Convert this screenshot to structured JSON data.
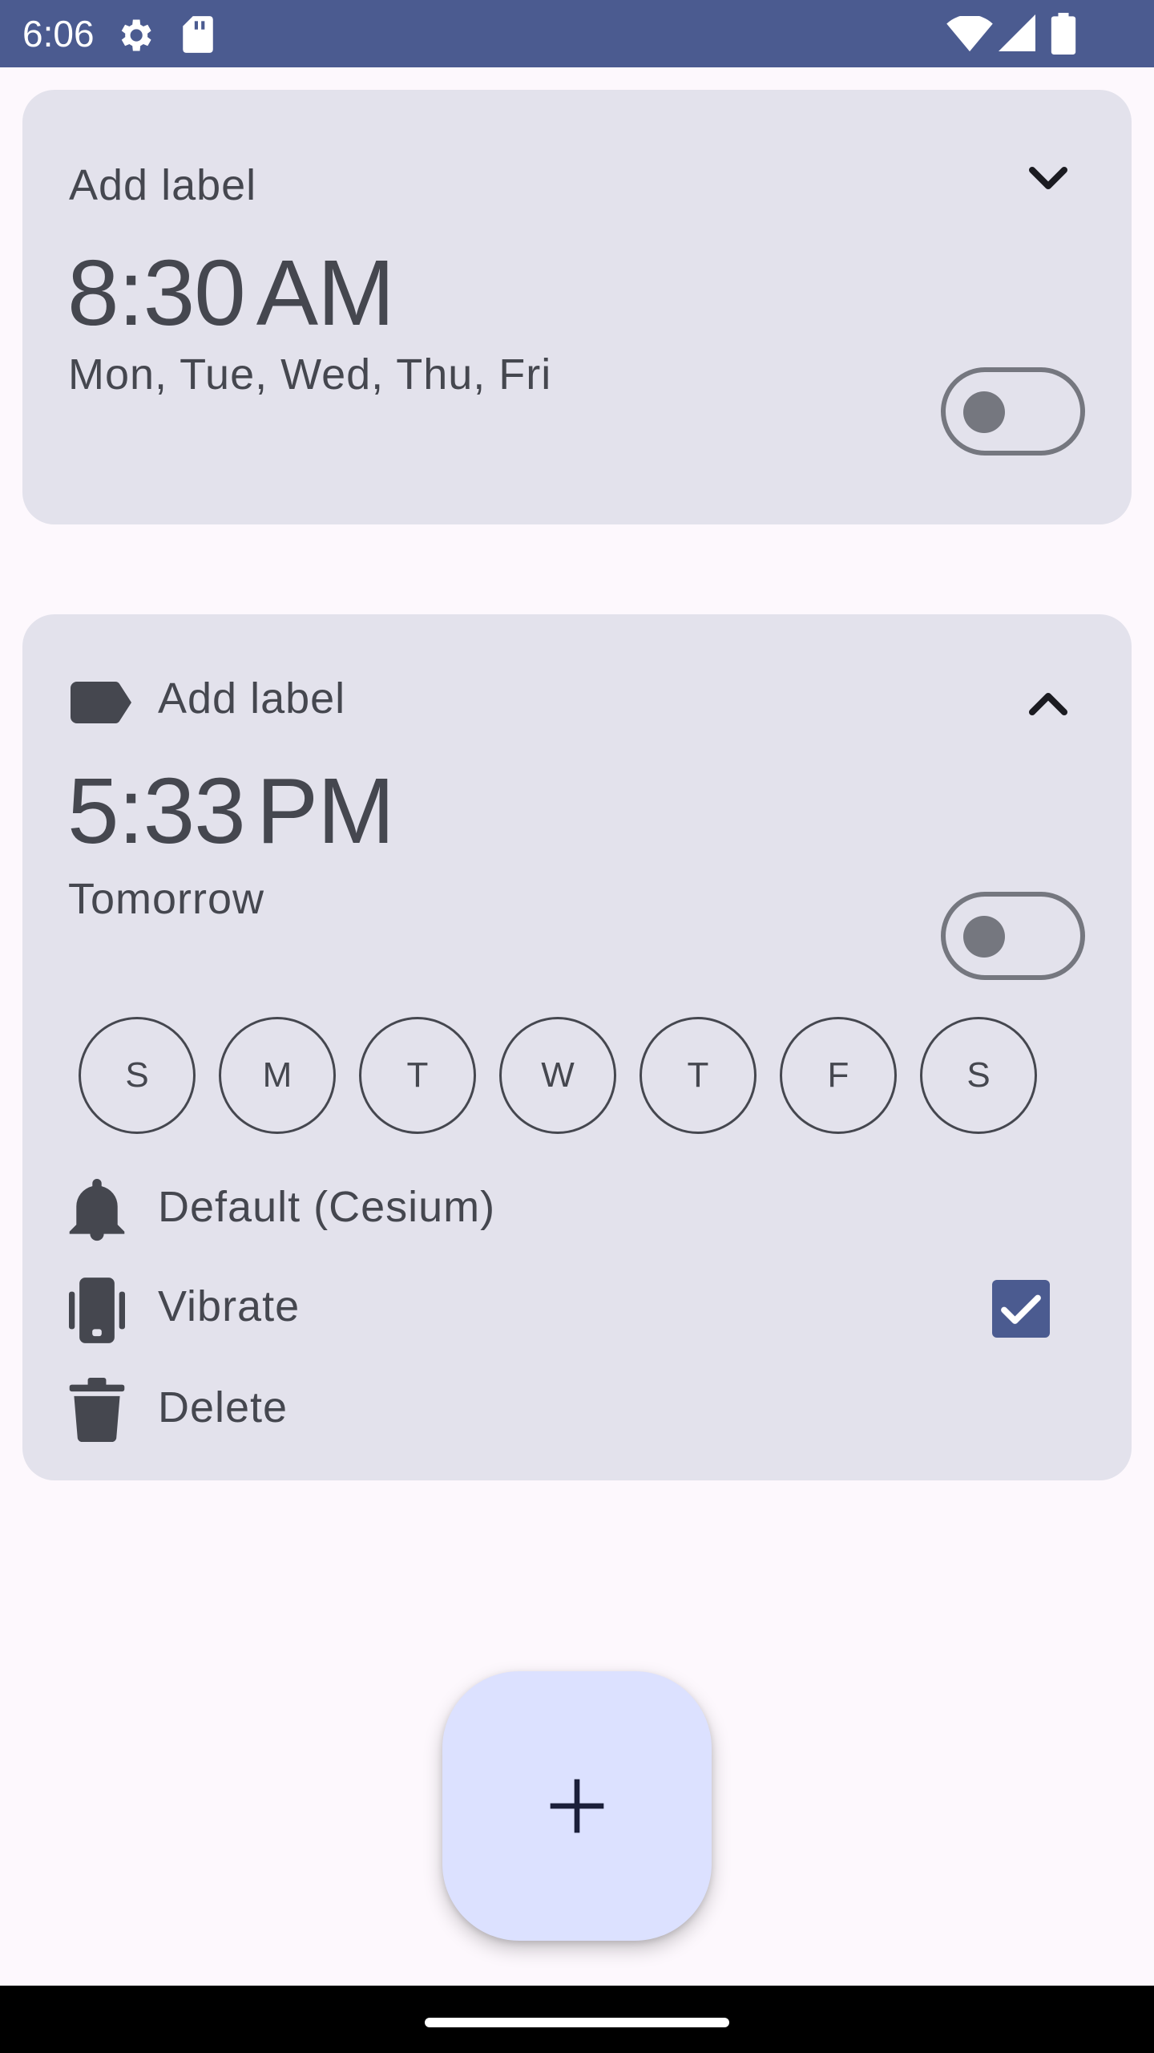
{
  "status_bar": {
    "time": "6:06",
    "icons": [
      "settings-gear-icon",
      "sd-card-icon",
      "wifi-icon",
      "cell-signal-icon",
      "battery-icon"
    ]
  },
  "alarms": [
    {
      "label": "Add label",
      "time": "8:30",
      "ampm": "AM",
      "schedule": "Mon, Tue, Wed, Thu, Fri",
      "enabled": false,
      "expanded": false
    },
    {
      "label": "Add label",
      "time": "5:33",
      "ampm": "PM",
      "schedule": "Tomorrow",
      "enabled": false,
      "expanded": true,
      "days": [
        "S",
        "M",
        "T",
        "W",
        "T",
        "F",
        "S"
      ],
      "ringtone": "Default (Cesium)",
      "vibrate_label": "Vibrate",
      "vibrate": true,
      "delete_label": "Delete"
    }
  ],
  "colors": {
    "status_bar": "#4b5b90",
    "card": "#e3e2ec",
    "background": "#fdf8fd",
    "checkbox": "#4b5b90",
    "fab": "#dce1ff",
    "text": "#45474f"
  }
}
